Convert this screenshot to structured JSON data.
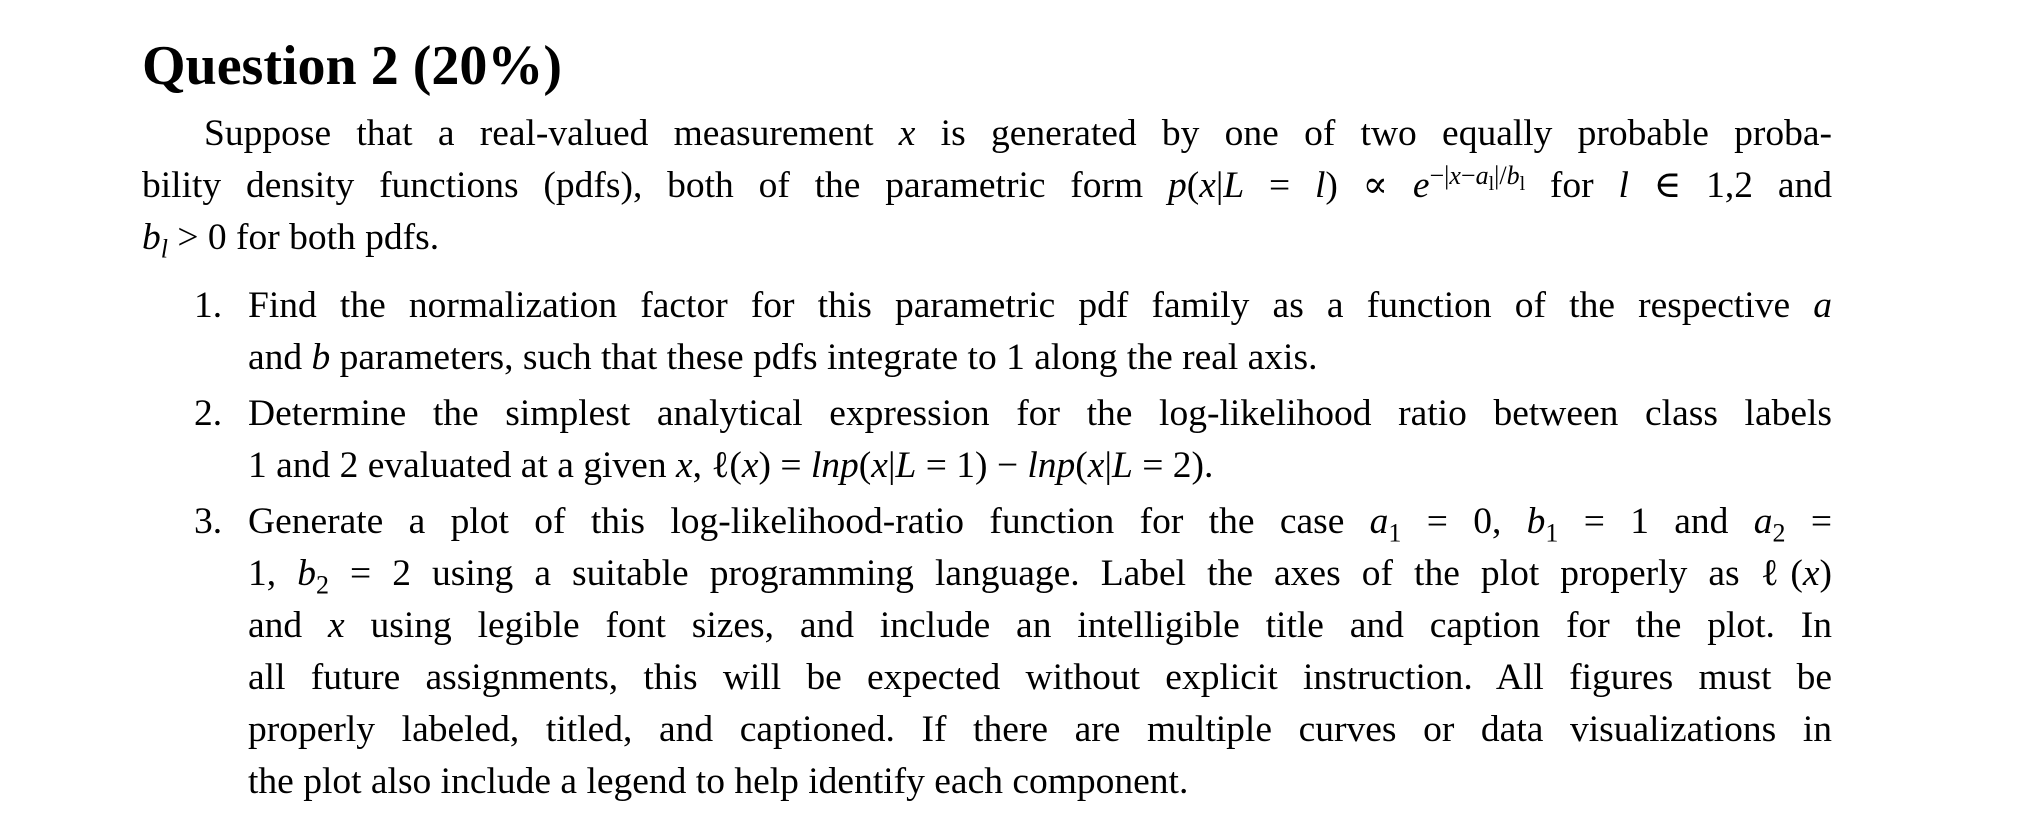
{
  "question": {
    "title": "Question 2 (20%)",
    "intro": [
      "Suppose that a real-valued measurement x is generated by one of two equally probable proba-",
      "bility density functions (pdfs), both of the parametric form p(x|L = l) ∝ e^{−|x−a_l|/b_l} for l ∈ 1,2 and",
      "b_l > 0 for both pdfs."
    ],
    "items": [
      {
        "number": "1.",
        "lines": [
          "Find the normalization factor for this parametric pdf family as a function of the respective a",
          "and b parameters, such that these pdfs integrate to 1 along the real axis."
        ]
      },
      {
        "number": "2.",
        "lines": [
          "Determine the simplest analytical expression for the log-likelihood ratio between class labels",
          "1 and 2 evaluated at a given x, ℓ(x) = lnp(x|L = 1) − lnp(x|L = 2)."
        ]
      },
      {
        "number": "3.",
        "lines": [
          "Generate a plot of this log-likelihood-ratio function for the case a1 = 0, b1 = 1 and a2 =",
          "1, b2 = 2 using a suitable programming language. Label the axes of the plot properly as ℓ(x)",
          "and x using legible font sizes, and include an intelligible title and caption for the plot. In",
          "all future assignments, this will be expected without explicit instruction. All figures must be",
          "properly labeled, titled, and captioned. If there are multiple curves or data visualizations in",
          "the plot also include a legend to help identify each component."
        ]
      }
    ]
  }
}
